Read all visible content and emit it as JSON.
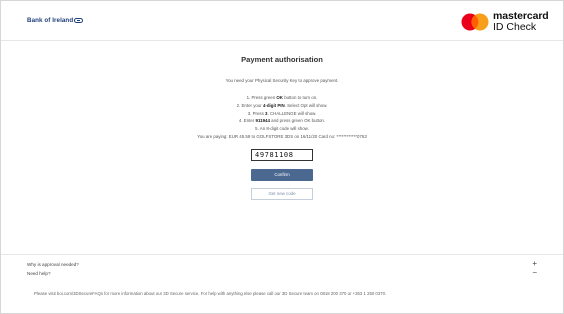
{
  "header": {
    "bank_name": "Bank of Ireland",
    "mastercard_word": "mastercard",
    "mastercard_sub": "ID Check",
    "brand_colors": {
      "bank_blue": "#1b3d7a",
      "mc_red": "#eb001b",
      "mc_yellow": "#f79e1b",
      "mc_orange": "#ff5f00"
    }
  },
  "main": {
    "title": "Payment authorisation",
    "intro": "You need your Physical Security Key to approve payment.",
    "steps": [
      {
        "pre": "1. Press green ",
        "bold": "OK",
        "post": " button to turn on."
      },
      {
        "pre": "2. Enter your ",
        "bold": "4-digit PIN",
        "post": ". Select Opt will show."
      },
      {
        "pre": "3. Press ",
        "bold": "3",
        "post": ". CHALLENGE will show."
      },
      {
        "pre": "4. Enter ",
        "bold": "911944",
        "post": " and press green OK button."
      },
      {
        "pre": "",
        "bold": "",
        "post": "5. An 8-digit code will show."
      }
    ],
    "paying": "You are paying: EUR 45.59 to GOLFSTORE 3DS on 16/11/20 Card no: ************0763",
    "code_value": "49781108",
    "confirm_label": "Confirm",
    "new_code_label": "Get new code"
  },
  "footer": {
    "faq1_label": "Why is approval needed?",
    "faq1_sign": "+",
    "faq2_label": "Need help?",
    "faq2_sign": "−",
    "note": "Please visit boi.com/3DSecureFAQs for more information about our 3D Secure service. For help with anything else please call our 3D Secure team on 0818 200 370 or +353 1 250 0370."
  }
}
